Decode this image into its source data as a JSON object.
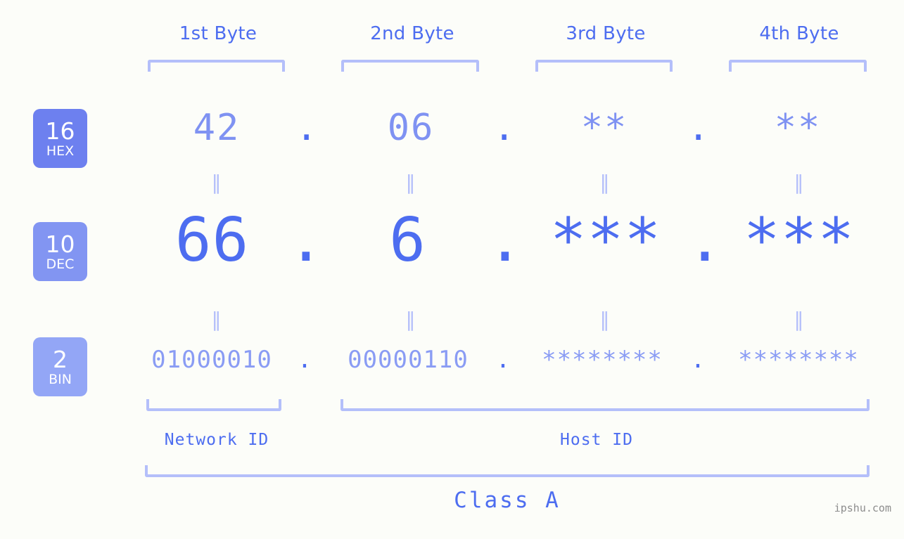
{
  "meta": {
    "watermark": "ipshu.com",
    "background_color": "#fcfdf9",
    "accent_color": "#4d6df0",
    "accent_light_color": "#8a9cf4",
    "bracket_color": "#b4bffa"
  },
  "byte_headers": [
    {
      "label": "1st Byte"
    },
    {
      "label": "2nd Byte"
    },
    {
      "label": "3rd Byte"
    },
    {
      "label": "4th Byte"
    }
  ],
  "bases": [
    {
      "num": "16",
      "sub": "HEX",
      "color": "#6d80ef"
    },
    {
      "num": "10",
      "sub": "DEC",
      "color": "#8295f2"
    },
    {
      "num": "2",
      "sub": "BIN",
      "color": "#93a6f6"
    }
  ],
  "rows": {
    "hex": {
      "values": [
        "42",
        "06",
        "**",
        "**"
      ],
      "separator": "."
    },
    "dec": {
      "values": [
        "66",
        "6",
        "***",
        "***"
      ],
      "separator": "."
    },
    "bin": {
      "values": [
        "01000010",
        "00000110",
        "********",
        "********"
      ],
      "separator": "."
    }
  },
  "equals_symbol": "‖",
  "sections": [
    {
      "label": "Network ID"
    },
    {
      "label": "Host ID"
    }
  ],
  "class": {
    "label": "Class A"
  }
}
